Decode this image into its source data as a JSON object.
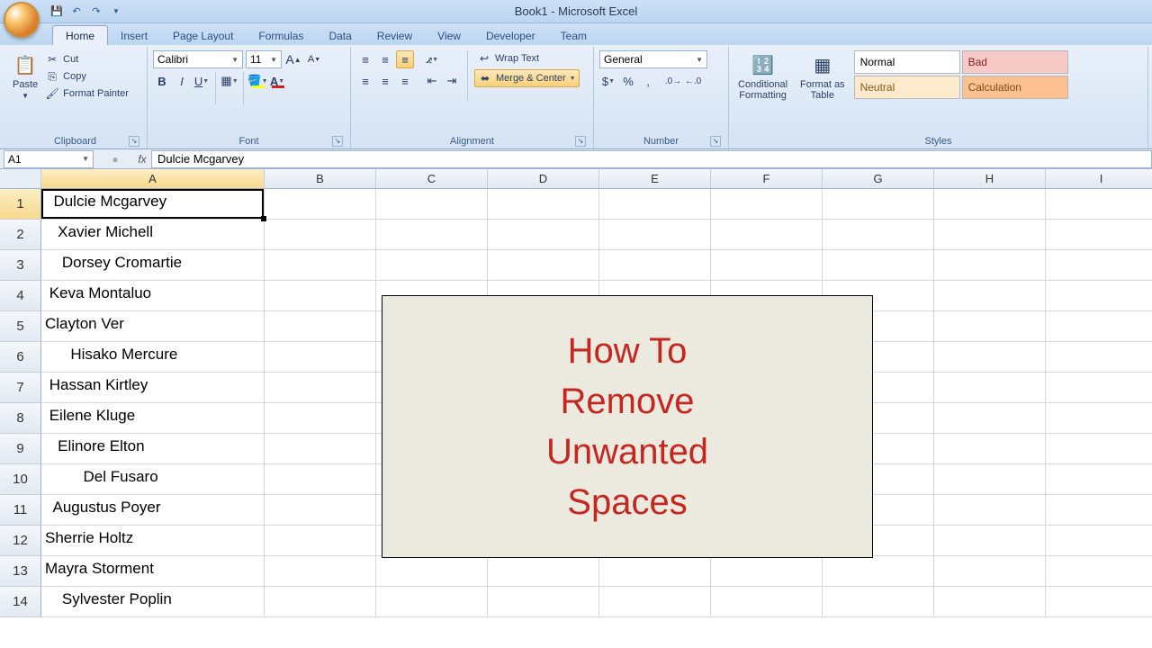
{
  "title": "Book1 - Microsoft Excel",
  "tabs": [
    "Home",
    "Insert",
    "Page Layout",
    "Formulas",
    "Data",
    "Review",
    "View",
    "Developer",
    "Team"
  ],
  "activeTab": "Home",
  "groups": {
    "clipboard": {
      "label": "Clipboard",
      "paste": "Paste",
      "cut": "Cut",
      "copy": "Copy",
      "fp": "Format Painter"
    },
    "font": {
      "label": "Font",
      "name": "Calibri",
      "size": "11"
    },
    "alignment": {
      "label": "Alignment",
      "wrap": "Wrap Text",
      "merge": "Merge & Center"
    },
    "number": {
      "label": "Number",
      "format": "General"
    },
    "styles": {
      "label": "Styles",
      "cf": "Conditional\nFormatting",
      "fat": "Format as\nTable",
      "normal": "Normal",
      "bad": "Bad",
      "neutral": "Neutral",
      "calc": "Calculation"
    }
  },
  "formulaBar": {
    "cellRef": "A1",
    "value": "   Dulcie Mcgarvey"
  },
  "columns": [
    "A",
    "B",
    "C",
    "D",
    "E",
    "F",
    "G",
    "H",
    "I"
  ],
  "colWidths": {
    "A": 248,
    "other": 124
  },
  "rowCount": 14,
  "dataA": [
    "  Dulcie Mcgarvey",
    "   Xavier Michell",
    "    Dorsey Cromartie",
    " Keva Montaluo",
    "Clayton Ver",
    "      Hisako Mercure",
    " Hassan Kirtley",
    " Eilene Kluge",
    "   Elinore Elton",
    "         Del Fusaro",
    "  Augustus Poyer",
    "Sherrie Holtz",
    "Mayra Storment",
    "    Sylvester Poplin"
  ],
  "overlay": {
    "lines": [
      "How To",
      "Remove",
      "Unwanted",
      "Spaces"
    ]
  }
}
